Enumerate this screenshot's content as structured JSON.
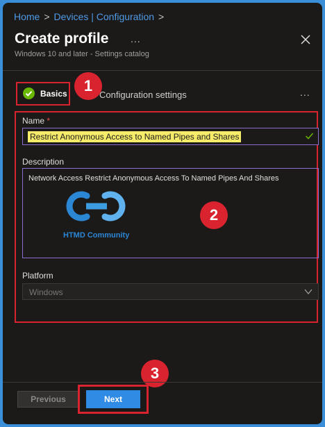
{
  "breadcrumb": {
    "items": [
      "Home",
      "Devices | Configuration"
    ]
  },
  "header": {
    "title": "Create profile",
    "more": "...",
    "subtitle": "Windows 10 and later - Settings catalog"
  },
  "tabs": {
    "basics": "Basics",
    "config": "Configuration settings",
    "more": "..."
  },
  "form": {
    "name_label": "Name",
    "required_mark": "*",
    "name_value": "Restrict Anonymous Access to Named Pipes and Shares",
    "description_label": "Description",
    "description_value": "Network Access Restrict Anonymous Access To Named Pipes And Shares",
    "platform_label": "Platform",
    "platform_value": "Windows"
  },
  "watermark": {
    "text": "HTMD Community"
  },
  "annotations": [
    "1",
    "2",
    "3"
  ],
  "footer": {
    "previous": "Previous",
    "next": "Next"
  },
  "colors": {
    "accent": "#2f8be3",
    "highlight_red": "#d9232f",
    "success": "#6bb700"
  }
}
